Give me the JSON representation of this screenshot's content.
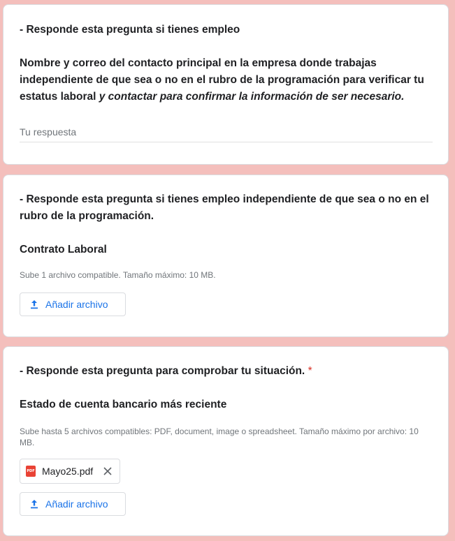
{
  "questions": [
    {
      "title": "- Responde esta pregunta si tienes empleo",
      "description_main": "Nombre y correo del contacto principal en la empresa donde trabajas independiente de que sea o no en el rubro de la programación  para verificar tu estatus laboral",
      "description_italic": " y contactar para confirmar la información de ser necesario.",
      "answer_placeholder": "Tu respuesta"
    },
    {
      "title": "- Responde esta pregunta si tienes empleo independiente de que sea o no en el rubro de la programación.",
      "description": "Contrato Laboral",
      "upload_hint": "Sube 1 archivo compatible. Tamaño máximo: 10 MB.",
      "add_file_label": "Añadir archivo"
    },
    {
      "title": "- Responde esta pregunta para comprobar tu situación.",
      "required_mark": "*",
      "description": "Estado de cuenta bancario más reciente",
      "upload_hint": "Sube hasta 5 archivos compatibles: PDF, document, image o spreadsheet. Tamaño máximo por archivo: 10 MB.",
      "attached_file": {
        "name": "Mayo25.pdf",
        "icon": "pdf-file-icon",
        "badge": "PDF"
      },
      "add_file_label": "Añadir archivo"
    }
  ],
  "colors": {
    "background": "#f4bfbc",
    "accent": "#1a73e8",
    "required": "#d93025",
    "pdf": "#e94235"
  },
  "icons": {
    "upload": "upload-icon",
    "remove": "close-icon"
  }
}
